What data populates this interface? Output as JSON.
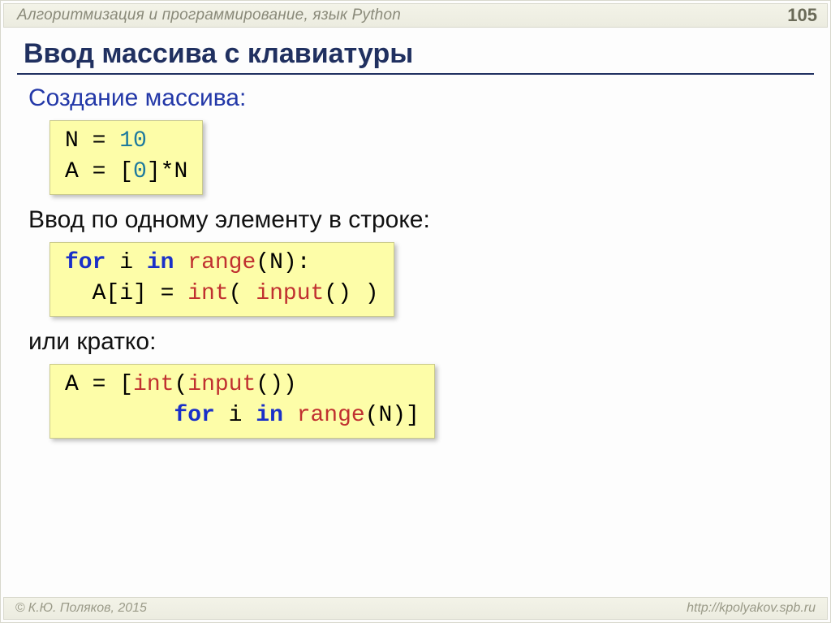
{
  "breadcrumb_prefix": "Алгоритмизация и программирование",
  "breadcrumb_sep": ", ",
  "breadcrumb_lang": "язык Python",
  "page_number": "105",
  "title": "Ввод массива с клавиатуры",
  "sub1": "Создание массива:",
  "code1": {
    "l1a": "N",
    "l1b": " = ",
    "l1c": "10",
    "l2a": "A",
    "l2b": " = [",
    "l2c": "0",
    "l2d": "]*N"
  },
  "sub2": "Ввод по одному элементу в строке:",
  "code2": {
    "l1a": "for",
    "l1b": " i ",
    "l1c": "in",
    "l1d": " ",
    "l1e": "range",
    "l1f": "(N):",
    "l2a": "  A[i]",
    "l2b": " = ",
    "l2c": "int",
    "l2d": "( ",
    "l2e": "input",
    "l2f": "() )"
  },
  "sub3": "или кратко:",
  "code3": {
    "l1a": "A",
    "l1b": " = [",
    "l1c": "int",
    "l1d": "(",
    "l1e": "input",
    "l1f": "())",
    "l2a": "        ",
    "l2b": "for",
    "l2c": " i ",
    "l2d": "in",
    "l2e": " ",
    "l2f": "range",
    "l2g": "(N)]"
  },
  "footer_copy": "К.Ю. Поляков, 2015",
  "footer_url": "http://kpolyakov.spb.ru"
}
